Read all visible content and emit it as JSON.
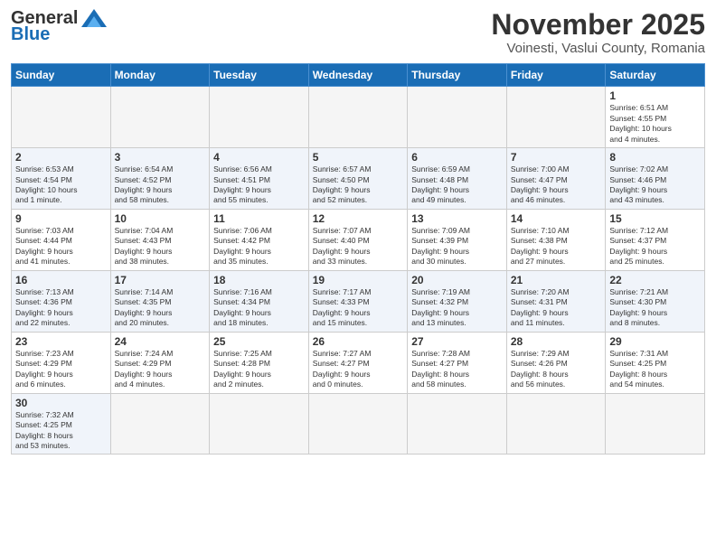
{
  "header": {
    "logo": {
      "line1": "General",
      "line2": "Blue"
    },
    "title": "November 2025",
    "location": "Voinesti, Vaslui County, Romania"
  },
  "weekdays": [
    "Sunday",
    "Monday",
    "Tuesday",
    "Wednesday",
    "Thursday",
    "Friday",
    "Saturday"
  ],
  "weeks": [
    [
      {
        "day": "",
        "info": ""
      },
      {
        "day": "",
        "info": ""
      },
      {
        "day": "",
        "info": ""
      },
      {
        "day": "",
        "info": ""
      },
      {
        "day": "",
        "info": ""
      },
      {
        "day": "",
        "info": ""
      },
      {
        "day": "1",
        "info": "Sunrise: 6:51 AM\nSunset: 4:55 PM\nDaylight: 10 hours\nand 4 minutes."
      }
    ],
    [
      {
        "day": "2",
        "info": "Sunrise: 6:53 AM\nSunset: 4:54 PM\nDaylight: 10 hours\nand 1 minute."
      },
      {
        "day": "3",
        "info": "Sunrise: 6:54 AM\nSunset: 4:52 PM\nDaylight: 9 hours\nand 58 minutes."
      },
      {
        "day": "4",
        "info": "Sunrise: 6:56 AM\nSunset: 4:51 PM\nDaylight: 9 hours\nand 55 minutes."
      },
      {
        "day": "5",
        "info": "Sunrise: 6:57 AM\nSunset: 4:50 PM\nDaylight: 9 hours\nand 52 minutes."
      },
      {
        "day": "6",
        "info": "Sunrise: 6:59 AM\nSunset: 4:48 PM\nDaylight: 9 hours\nand 49 minutes."
      },
      {
        "day": "7",
        "info": "Sunrise: 7:00 AM\nSunset: 4:47 PM\nDaylight: 9 hours\nand 46 minutes."
      },
      {
        "day": "8",
        "info": "Sunrise: 7:02 AM\nSunset: 4:46 PM\nDaylight: 9 hours\nand 43 minutes."
      }
    ],
    [
      {
        "day": "9",
        "info": "Sunrise: 7:03 AM\nSunset: 4:44 PM\nDaylight: 9 hours\nand 41 minutes."
      },
      {
        "day": "10",
        "info": "Sunrise: 7:04 AM\nSunset: 4:43 PM\nDaylight: 9 hours\nand 38 minutes."
      },
      {
        "day": "11",
        "info": "Sunrise: 7:06 AM\nSunset: 4:42 PM\nDaylight: 9 hours\nand 35 minutes."
      },
      {
        "day": "12",
        "info": "Sunrise: 7:07 AM\nSunset: 4:40 PM\nDaylight: 9 hours\nand 33 minutes."
      },
      {
        "day": "13",
        "info": "Sunrise: 7:09 AM\nSunset: 4:39 PM\nDaylight: 9 hours\nand 30 minutes."
      },
      {
        "day": "14",
        "info": "Sunrise: 7:10 AM\nSunset: 4:38 PM\nDaylight: 9 hours\nand 27 minutes."
      },
      {
        "day": "15",
        "info": "Sunrise: 7:12 AM\nSunset: 4:37 PM\nDaylight: 9 hours\nand 25 minutes."
      }
    ],
    [
      {
        "day": "16",
        "info": "Sunrise: 7:13 AM\nSunset: 4:36 PM\nDaylight: 9 hours\nand 22 minutes."
      },
      {
        "day": "17",
        "info": "Sunrise: 7:14 AM\nSunset: 4:35 PM\nDaylight: 9 hours\nand 20 minutes."
      },
      {
        "day": "18",
        "info": "Sunrise: 7:16 AM\nSunset: 4:34 PM\nDaylight: 9 hours\nand 18 minutes."
      },
      {
        "day": "19",
        "info": "Sunrise: 7:17 AM\nSunset: 4:33 PM\nDaylight: 9 hours\nand 15 minutes."
      },
      {
        "day": "20",
        "info": "Sunrise: 7:19 AM\nSunset: 4:32 PM\nDaylight: 9 hours\nand 13 minutes."
      },
      {
        "day": "21",
        "info": "Sunrise: 7:20 AM\nSunset: 4:31 PM\nDaylight: 9 hours\nand 11 minutes."
      },
      {
        "day": "22",
        "info": "Sunrise: 7:21 AM\nSunset: 4:30 PM\nDaylight: 9 hours\nand 8 minutes."
      }
    ],
    [
      {
        "day": "23",
        "info": "Sunrise: 7:23 AM\nSunset: 4:29 PM\nDaylight: 9 hours\nand 6 minutes."
      },
      {
        "day": "24",
        "info": "Sunrise: 7:24 AM\nSunset: 4:29 PM\nDaylight: 9 hours\nand 4 minutes."
      },
      {
        "day": "25",
        "info": "Sunrise: 7:25 AM\nSunset: 4:28 PM\nDaylight: 9 hours\nand 2 minutes."
      },
      {
        "day": "26",
        "info": "Sunrise: 7:27 AM\nSunset: 4:27 PM\nDaylight: 9 hours\nand 0 minutes."
      },
      {
        "day": "27",
        "info": "Sunrise: 7:28 AM\nSunset: 4:27 PM\nDaylight: 8 hours\nand 58 minutes."
      },
      {
        "day": "28",
        "info": "Sunrise: 7:29 AM\nSunset: 4:26 PM\nDaylight: 8 hours\nand 56 minutes."
      },
      {
        "day": "29",
        "info": "Sunrise: 7:31 AM\nSunset: 4:25 PM\nDaylight: 8 hours\nand 54 minutes."
      }
    ],
    [
      {
        "day": "30",
        "info": "Sunrise: 7:32 AM\nSunset: 4:25 PM\nDaylight: 8 hours\nand 53 minutes."
      },
      {
        "day": "",
        "info": ""
      },
      {
        "day": "",
        "info": ""
      },
      {
        "day": "",
        "info": ""
      },
      {
        "day": "",
        "info": ""
      },
      {
        "day": "",
        "info": ""
      },
      {
        "day": "",
        "info": ""
      }
    ]
  ]
}
